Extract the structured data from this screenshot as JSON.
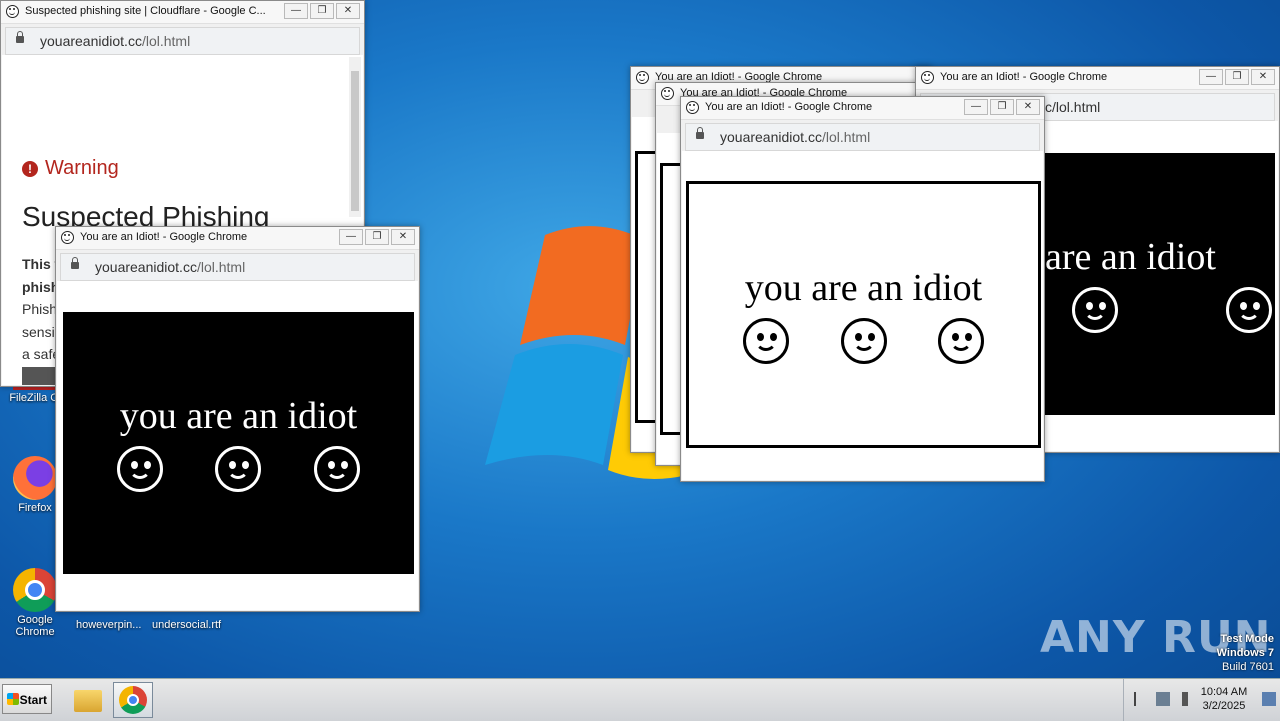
{
  "desktop": {
    "icons": [
      {
        "label": "FileZilla Cl"
      },
      {
        "label": "Firefox"
      },
      {
        "label": "Google Chrome"
      }
    ],
    "file_labels": [
      "howeverpin...",
      "undersocial.rtf"
    ],
    "watermark": "ANY RUN",
    "test_mode": {
      "line1": "Test Mode",
      "line2": "Windows 7",
      "line3": "Build 7601"
    }
  },
  "phishing_window": {
    "title": "Suspected phishing site | Cloudflare - Google C...",
    "url_host": "youareanidiot.cc",
    "url_path": "/lol.html",
    "warning_label": "Warning",
    "heading": "Suspected Phishing",
    "partial_lines": [
      "This w",
      "phish",
      "Phish",
      "sensi",
      "a safe"
    ]
  },
  "idiot_windows": {
    "title": "You are an Idiot! - Google Chrome",
    "url_host": "youareanidiot.cc",
    "url_path": "/lol.html",
    "url_partial": "c/lol.html",
    "message": "you are an idiot",
    "message_partial": "are an idiot"
  },
  "window_controls": {
    "minimize": "—",
    "maximize": "❐",
    "close": "✕"
  },
  "taskbar": {
    "start_label": "Start",
    "clock_time": "10:04 AM",
    "clock_date": "3/2/2025"
  },
  "colors": {
    "warning_red": "#b3261e",
    "desktop_blue": "#1a78c8"
  }
}
